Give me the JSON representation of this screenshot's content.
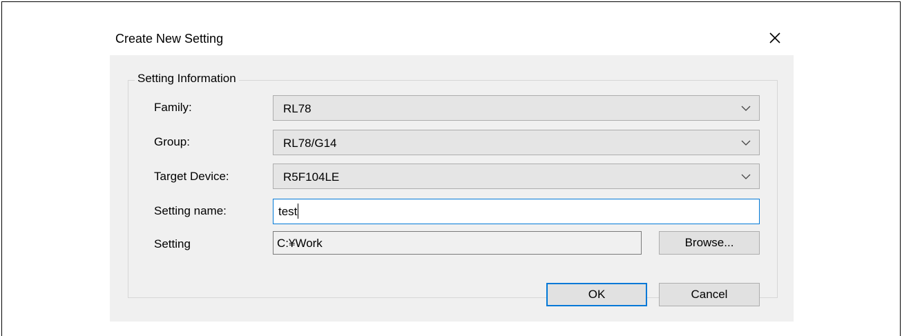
{
  "dialog": {
    "title": "Create New Setting",
    "close_icon": "close-icon"
  },
  "group": {
    "legend": "Setting Information"
  },
  "fields": {
    "family": {
      "label": "Family:",
      "value": "RL78"
    },
    "group": {
      "label": "Group:",
      "value": "RL78/G14"
    },
    "target_device": {
      "label": "Target Device:",
      "value": "R5F104LE"
    },
    "setting_name": {
      "label": "Setting name:",
      "value": "test"
    },
    "setting_path": {
      "label": "Setting",
      "value": "C:¥Work"
    }
  },
  "buttons": {
    "browse": "Browse...",
    "ok": "OK",
    "cancel": "Cancel"
  },
  "colors": {
    "focus": "#0078d7",
    "dialog_bg": "#f0f0f0"
  }
}
